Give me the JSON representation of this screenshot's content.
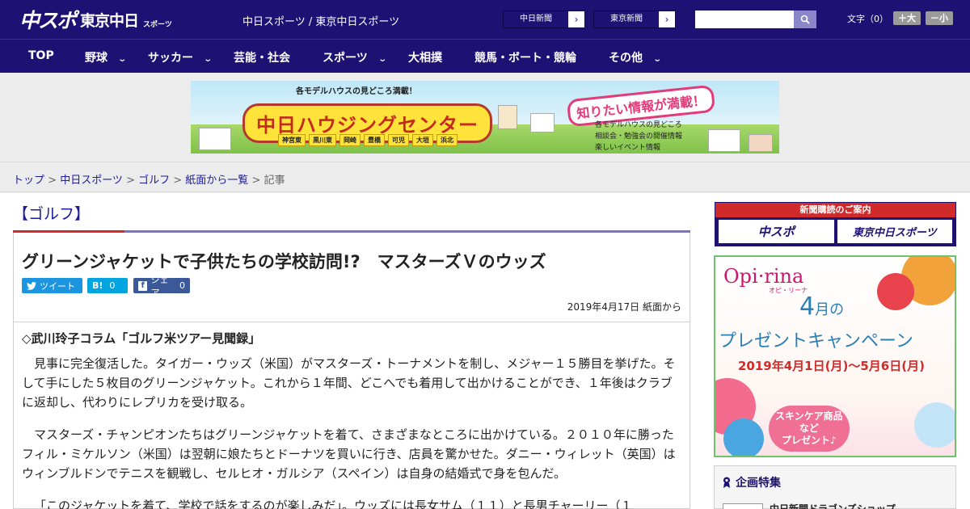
{
  "header": {
    "logo_main": "中スポ",
    "logo_sub": "東京中日",
    "logo_sup": "スポーツ",
    "site_name": "中日スポーツ / 東京中日スポーツ",
    "paper_buttons": [
      "中日新聞",
      "東京新聞"
    ],
    "search_placeholder": "",
    "font_label": "文字（0）",
    "font_plus": "＋大",
    "font_minus": "－小"
  },
  "nav": {
    "items": [
      {
        "label": "TOP",
        "dropdown": false
      },
      {
        "label": "野球",
        "dropdown": true
      },
      {
        "label": "サッカー",
        "dropdown": true
      },
      {
        "label": "芸能・社会",
        "dropdown": false
      },
      {
        "label": "スポーツ",
        "dropdown": true
      },
      {
        "label": "大相撲",
        "dropdown": false
      },
      {
        "label": "競馬・ボート・競輪",
        "dropdown": false
      },
      {
        "label": "その他",
        "dropdown": true
      }
    ]
  },
  "banner": {
    "top_text": "各モデルハウスの見どころ満載！",
    "title": "中日ハウジングセンター",
    "cities": [
      "神宮東",
      "黒川東",
      "岡崎",
      "豊橋",
      "可児",
      "大垣",
      "浜北"
    ],
    "tagline": "知りたい情報が満載！",
    "list": [
      "各モデルハウスの見どころ",
      "相談会・勉強会の開催情報",
      "楽しいイベント情報"
    ]
  },
  "breadcrumb": {
    "items": [
      "トップ",
      "中日スポーツ",
      "ゴルフ",
      "紙面から一覧"
    ],
    "current": "記事",
    "sep": " > "
  },
  "article": {
    "category": "【ゴルフ】",
    "headline": "グリーンジャケットで子供たちの学校訪問!?　マスターズＶのウッズ",
    "share": {
      "tweet": "ツイート",
      "hatena": "B!",
      "hatena_count": "0",
      "fb": "シェア",
      "fb_count": "0"
    },
    "date": "2019年4月17日 紙面から",
    "column_title": "◇武川玲子コラム「ゴルフ米ツアー見聞録」",
    "paragraphs": [
      "見事に完全復活した。タイガー・ウッズ（米国）がマスターズ・トーナメントを制し、メジャー１５勝目を挙げた。そして手にした５枚目のグリーンジャケット。これから１年間、どこへでも着用して出かけることができ、１年後はクラブに返却し、代わりにレプリカを受け取る。",
      "マスターズ・チャンピオンたちはグリーンジャケットを着て、さまざまなところに出かけている。２０１０年に勝ったフィル・ミケルソン（米国）は翌朝に娘たちとドーナツを買いに行き、店員を驚かせた。ダニー・ウィレット（英国）はウィンブルドンでテニスを観戦し、セルヒオ・ガルシア（スペイン）は自身の結婚式で身を包んだ。",
      "「このジャケットを着て、学校で話をするのが楽しみだ」。ウッズには長女サム（１１）と長男チャーリー（１"
    ]
  },
  "sidebar": {
    "subscribe_head": "新聞購読のご案内",
    "subscribe_logos": [
      "中スポ",
      "東京中日スポーツ"
    ],
    "ad": {
      "brand": "Opi·rina",
      "brand_kana": "オピ・リーナ",
      "month": "4",
      "month_suffix": "月の",
      "title": "プレゼントキャンペーン",
      "date": "2019年4月1日(月)～5月6日(月)",
      "note_lines": [
        "スキンケア商品",
        "など",
        "プレゼント♪"
      ]
    },
    "feature_head": "企画特集",
    "feature_item": "中日新聞ドラゴンズショップ"
  },
  "colors": {
    "brand": "#1d1273",
    "accent_red": "#d02a2a",
    "link": "#1d1a9e",
    "twitter": "#1b95e0",
    "hatena": "#00a4de",
    "facebook": "#3b5998"
  }
}
